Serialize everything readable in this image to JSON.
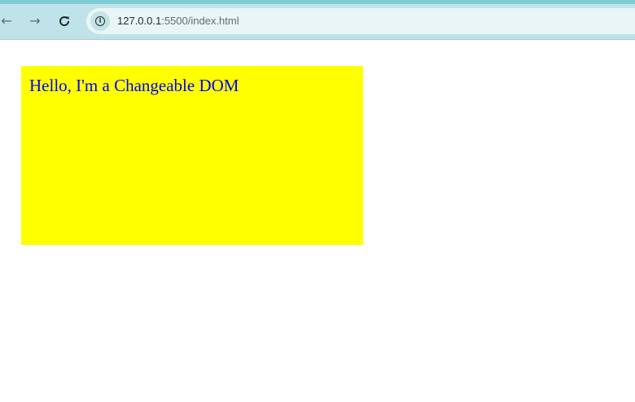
{
  "browser": {
    "url_host": "127.0.0.1",
    "url_rest": ":5500/index.html",
    "icons": {
      "back": "arrow-left-icon",
      "forward": "arrow-right-icon",
      "reload": "reload-icon",
      "site_info": "info-icon"
    }
  },
  "page": {
    "box_text": "Hello, I'm a Changeable DOM",
    "box_background": "#ffff00",
    "text_color": "#0000ff"
  }
}
